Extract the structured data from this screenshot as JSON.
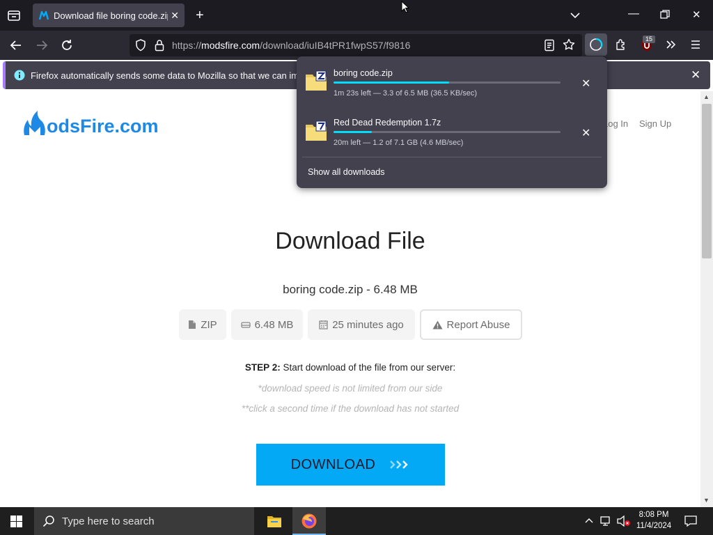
{
  "browser": {
    "tab_title": "Download file boring code.zip ·",
    "url_prefix": "https://",
    "url_host": "modsfire.com",
    "url_path": "/download/iuIB4tPR1fwpS57/f9816",
    "extension_badge": "15",
    "notification_text": "Firefox automatically sends some data to Mozilla so that we can improve"
  },
  "downloads_panel": {
    "items": [
      {
        "name": "boring code.zip",
        "status": "1m 23s left — 3.3 of 6.5 MB (36.5 KB/sec)",
        "progress": 0.51
      },
      {
        "name": "Red Dead Redemption 1.7z",
        "status": "20m left — 1.2 of 7.1 GB (4.6 MB/sec)",
        "progress": 0.17
      }
    ],
    "show_all_label": "Show all downloads"
  },
  "site": {
    "logo_text": "odsFire.com",
    "nav": {
      "login": "Log In",
      "signup": "Sign Up"
    },
    "heading": "Download File",
    "file_line": "boring code.zip - 6.48 MB",
    "pills": {
      "type": "ZIP",
      "size": "6.48 MB",
      "age": "25 minutes ago",
      "report": "Report Abuse"
    },
    "step_bold": "STEP 2:",
    "step_text": " Start download of the file from our server:",
    "note1": "*download speed is not limited from our side",
    "note2": "**click a second time if the download has not started",
    "download_button": "DOWNLOAD",
    "brand_color": "#03a9f4"
  },
  "taskbar": {
    "search_placeholder": "Type here to search",
    "time": "8:08 PM",
    "date": "11/4/2024"
  }
}
